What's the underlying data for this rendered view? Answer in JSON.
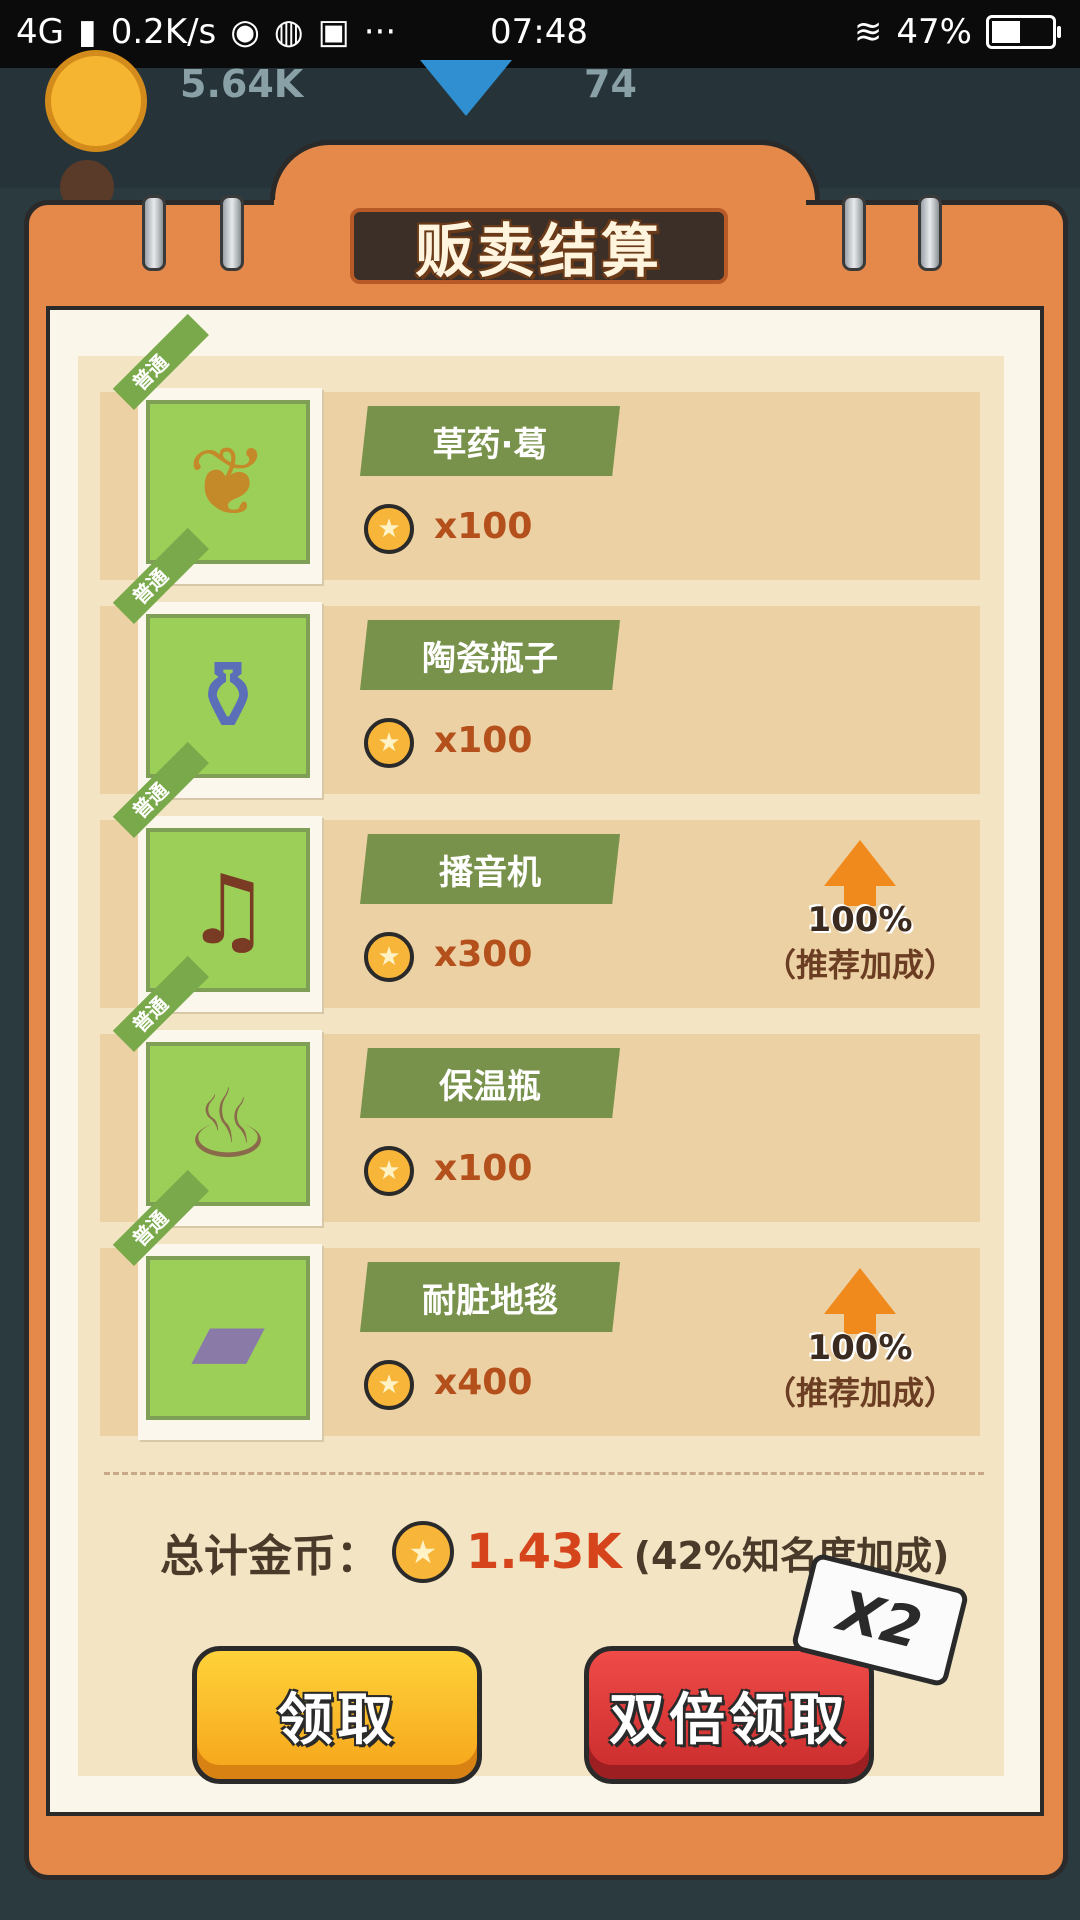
{
  "status_bar": {
    "network": "4G",
    "speed": "0.2K/s",
    "time": "07:48",
    "battery": "47%",
    "battery_level": 0.47
  },
  "background": {
    "coins": "5.64K",
    "gems": "74"
  },
  "title": "贩卖结算",
  "items": [
    {
      "tag": "普通",
      "name": "草药·葛",
      "price": "x100",
      "bonus": null
    },
    {
      "tag": "普通",
      "name": "陶瓷瓶子",
      "price": "x100",
      "bonus": null
    },
    {
      "tag": "普通",
      "name": "播音机",
      "price": "x300",
      "bonus": {
        "percent": "100%",
        "label": "（推荐加成）"
      }
    },
    {
      "tag": "普通",
      "name": "保温瓶",
      "price": "x100",
      "bonus": null
    },
    {
      "tag": "普通",
      "name": "耐脏地毯",
      "price": "x400",
      "bonus": {
        "percent": "100%",
        "label": "（推荐加成）"
      }
    }
  ],
  "total": {
    "label": "总计金币：",
    "value": "1.43K",
    "note": "(42%知名度加成)"
  },
  "buttons": {
    "claim": "领取",
    "double_claim": "双倍领取",
    "x2_badge": "X2"
  },
  "colors": {
    "panel": "#e5894a",
    "button_claim": "#f5a419",
    "button_double": "#c92b2c",
    "item_name_bg": "#79924b",
    "bonus_arrow": "#f08a1c"
  }
}
